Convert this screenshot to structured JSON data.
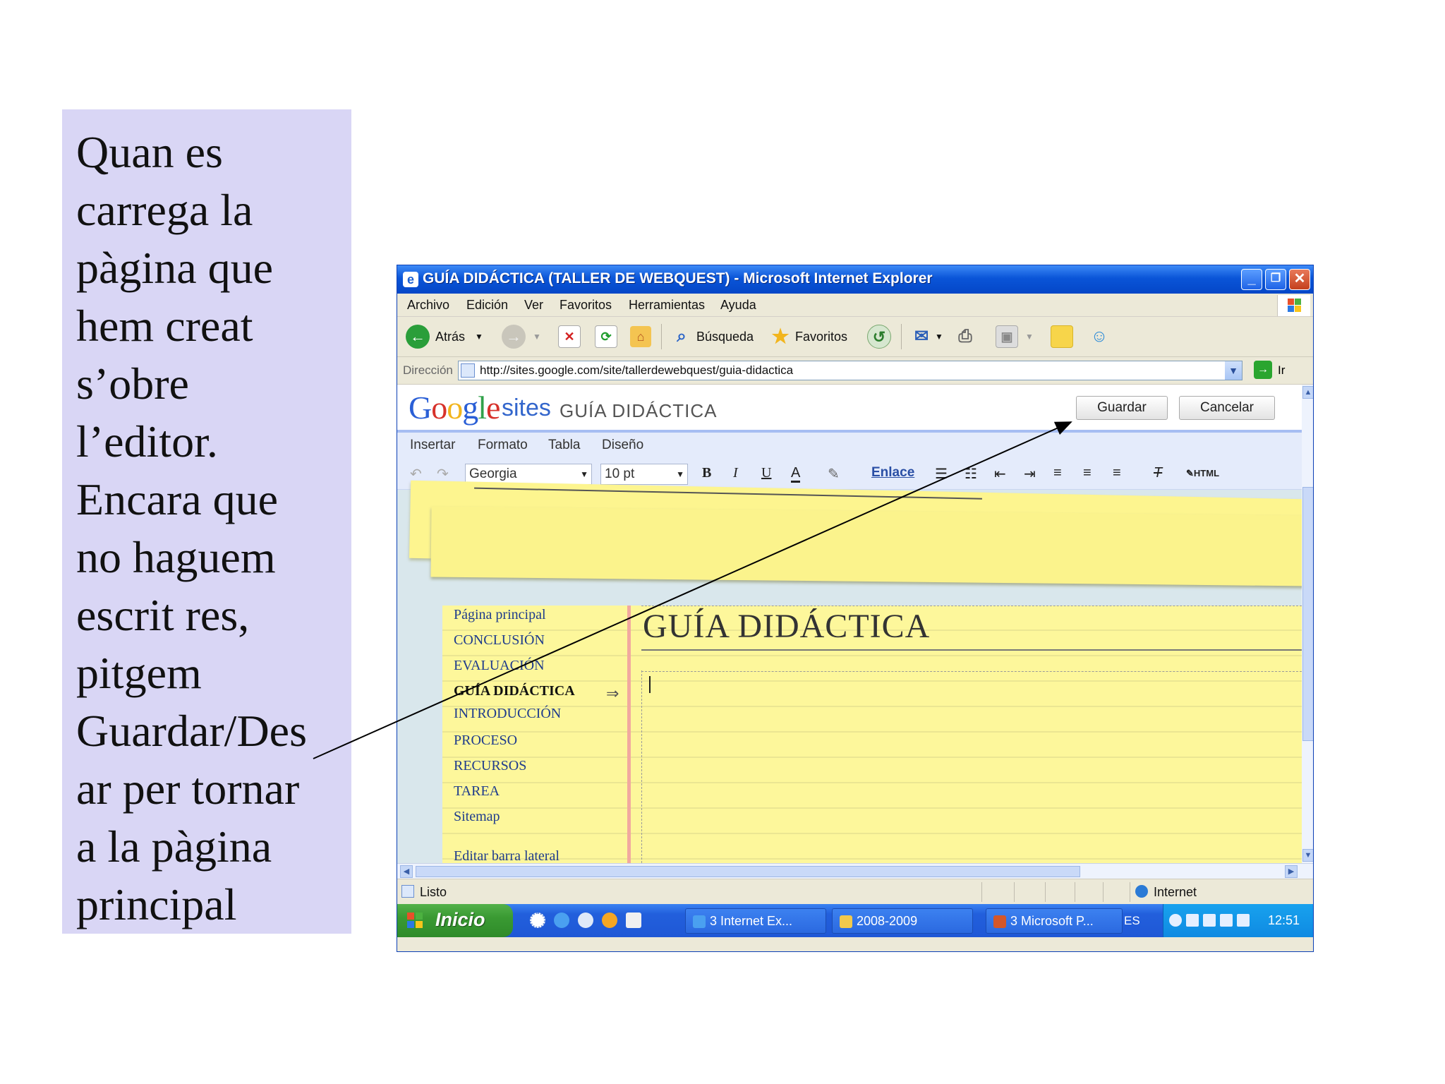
{
  "caption": {
    "text": "Quan es\ncarrega la\npàgina que\nhem creat\ns’obre\nl’editor.\nEncara que\nno haguem\nescrit res,\npitgem\nGuardar/Des\nar per tornar\na la pàgina\nprincipal"
  },
  "window": {
    "title": "GUÍA DIDÁCTICA (TALLER DE WEBQUEST) - Microsoft Internet Explorer",
    "min_glyph": "_",
    "max_glyph": "❐",
    "close_glyph": "✕"
  },
  "menubar": [
    "Archivo",
    "Edición",
    "Ver",
    "Favoritos",
    "Herramientas",
    "Ayuda"
  ],
  "toolbar": {
    "back_label": "Atrás",
    "search_label": "Búsqueda",
    "favorites_label": "Favoritos"
  },
  "address": {
    "label": "Dirección",
    "url": "http://sites.google.com/site/tallerdewebquest/guia-didactica",
    "go_label": "Ir"
  },
  "google_sites": {
    "logo": "Google",
    "sites": "sites",
    "page_title": "GUÍA DIDÁCTICA",
    "save_label": "Guardar",
    "cancel_label": "Cancelar"
  },
  "editor": {
    "menu": [
      "Insertar",
      "Formato",
      "Tabla",
      "Diseño"
    ],
    "font": "Georgia",
    "size": "10 pt",
    "bold": "B",
    "italic": "I",
    "underline": "U",
    "link_label": "Enlace",
    "html_label": "HTML"
  },
  "sidebar_nav": [
    "Página principal",
    "CONCLUSIÓN",
    "EVALUACIÓN",
    "GUÍA DIDÁCTICA",
    "INTRODUCCIÓN",
    "PROCESO",
    "RECURSOS",
    "TAREA",
    "Sitemap",
    "Editar barra lateral"
  ],
  "page_heading": "GUÍA DIDÁCTICA",
  "status": {
    "text": "Listo",
    "zone": "Internet"
  },
  "taskbar": {
    "start_label": "Inicio",
    "tasks": [
      "3 Internet Ex...",
      "2008-2009",
      "3 Microsoft P..."
    ],
    "lang": "ES",
    "clock": "12:51"
  },
  "colors": {
    "caption_bg": "#d9d6f5",
    "titlebar": "#0a55d8",
    "notebook": "#fdf79b",
    "start": "#3a9a33"
  }
}
